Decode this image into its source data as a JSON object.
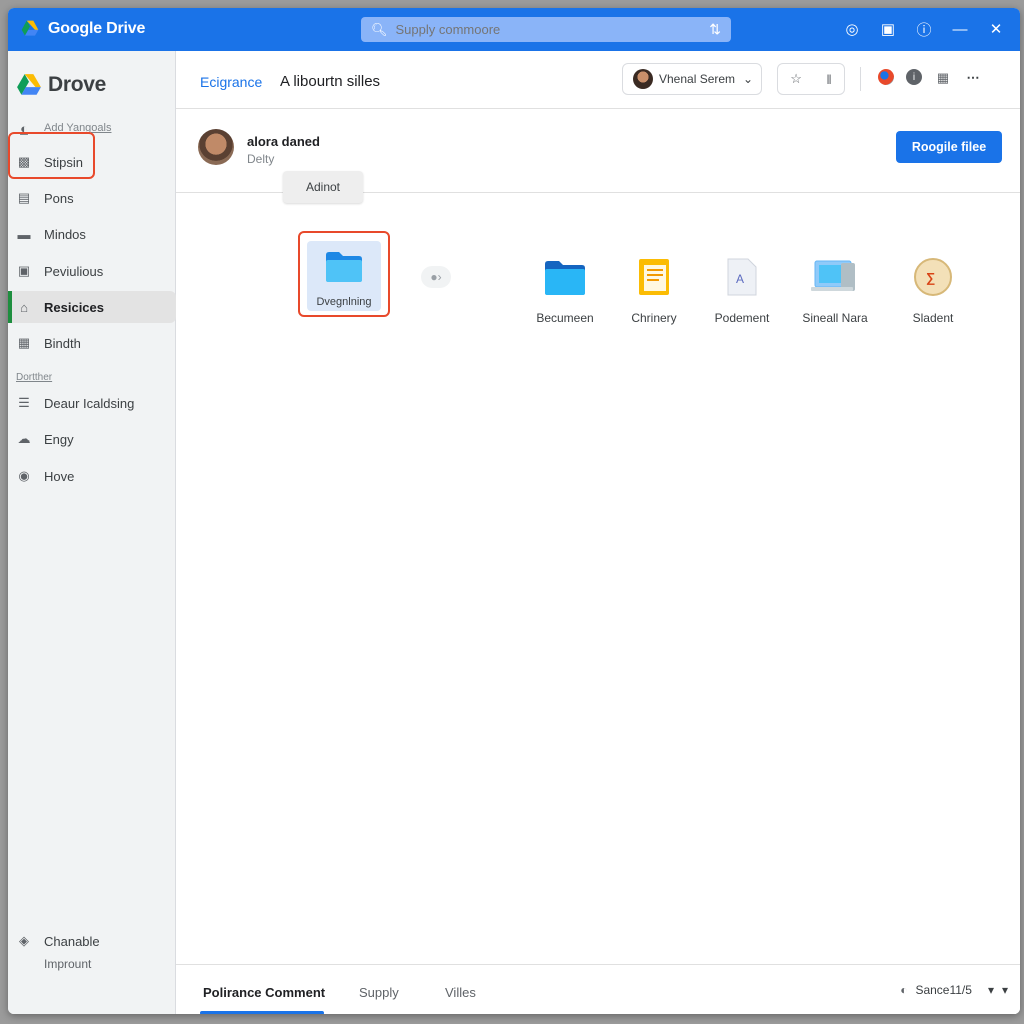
{
  "titlebar": {
    "title": "Google Drive",
    "search_placeholder": "Supply commoore",
    "icons": [
      "globe-icon",
      "camera-icon",
      "info-icon",
      "minimize-icon",
      "close-icon"
    ]
  },
  "sidebar": {
    "brand": "Drove",
    "add_link": "Add Yangoals",
    "items": [
      {
        "label": "Stipsin",
        "icon": "inbox-icon"
      },
      {
        "label": "Pons",
        "icon": "printer-icon"
      },
      {
        "label": "Mindos",
        "icon": "folder-icon"
      },
      {
        "label": "Peviulious",
        "icon": "photo-icon"
      },
      {
        "label": "Resicices",
        "icon": "home-icon"
      },
      {
        "label": "Bindth",
        "icon": "grid-icon"
      }
    ],
    "section_label": "Dortther",
    "items2": [
      {
        "label": "Deaur Icaldsing",
        "icon": "list-icon"
      },
      {
        "label": "Engy",
        "icon": "cloud-icon"
      },
      {
        "label": "Hove",
        "icon": "dot-icon"
      }
    ],
    "bottom_item": "Chanable",
    "bottom_sub": "Imprount"
  },
  "header": {
    "crumb1": "Ecigrance",
    "crumb2": "A libourtn silles",
    "account": "Vhenal Serem"
  },
  "user": {
    "name": "alora daned",
    "sub": "Delty",
    "tooltip": "Adinot",
    "button": "Roogile filee"
  },
  "files": [
    {
      "label": "Dvegnlning",
      "icon": "folder-icon"
    },
    {
      "label": "Becumeen",
      "icon": "folder-icon"
    },
    {
      "label": "Chrinery",
      "icon": "document-icon"
    },
    {
      "label": "Podement",
      "icon": "file-icon"
    },
    {
      "label": "Sineall Nara",
      "icon": "image-icon"
    },
    {
      "label": "Sladent",
      "icon": "badge-icon"
    }
  ],
  "footer": {
    "tabs": [
      "Polirance Comment",
      "Supply",
      "Villes"
    ],
    "status": "Sance11/5"
  },
  "colors": {
    "accent": "#1a73e8",
    "highlight": "#e8492b",
    "active_marker": "#1e8e3e"
  }
}
